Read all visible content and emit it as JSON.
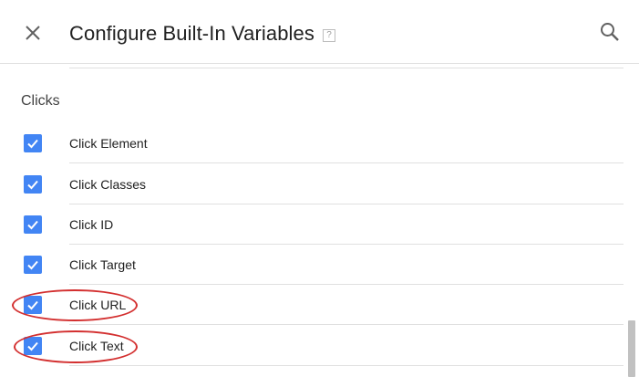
{
  "header": {
    "title": "Configure Built-In Variables",
    "help_glyph": "?"
  },
  "section": {
    "title": "Clicks"
  },
  "variables": [
    {
      "label": "Click Element",
      "checked": true
    },
    {
      "label": "Click Classes",
      "checked": true
    },
    {
      "label": "Click ID",
      "checked": true
    },
    {
      "label": "Click Target",
      "checked": true
    },
    {
      "label": "Click URL",
      "checked": true
    },
    {
      "label": "Click Text",
      "checked": true
    }
  ],
  "colors": {
    "checkbox": "#4285f4",
    "annotation": "#d32f2f",
    "divider": "#e0e0e0"
  },
  "icons": {
    "close": "close-icon",
    "search": "search-icon",
    "check": "check-icon"
  }
}
